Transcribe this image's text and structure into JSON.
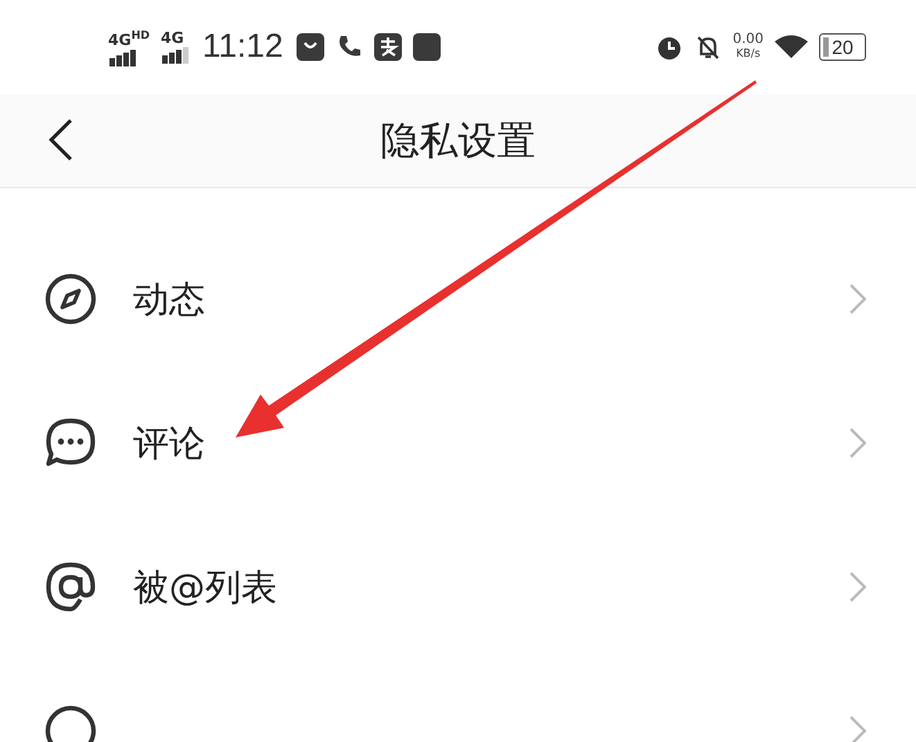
{
  "status_bar": {
    "signal_1": "4G",
    "signal_1_badge": "HD",
    "signal_2": "4G",
    "time": "11:12",
    "speed": "0.00",
    "speed_unit": "KB/s",
    "battery": "20"
  },
  "header": {
    "title": "隐私设置"
  },
  "rows": [
    {
      "label": "动态"
    },
    {
      "label": "评论"
    },
    {
      "label": "被@列表"
    }
  ],
  "more_rows_below": true
}
